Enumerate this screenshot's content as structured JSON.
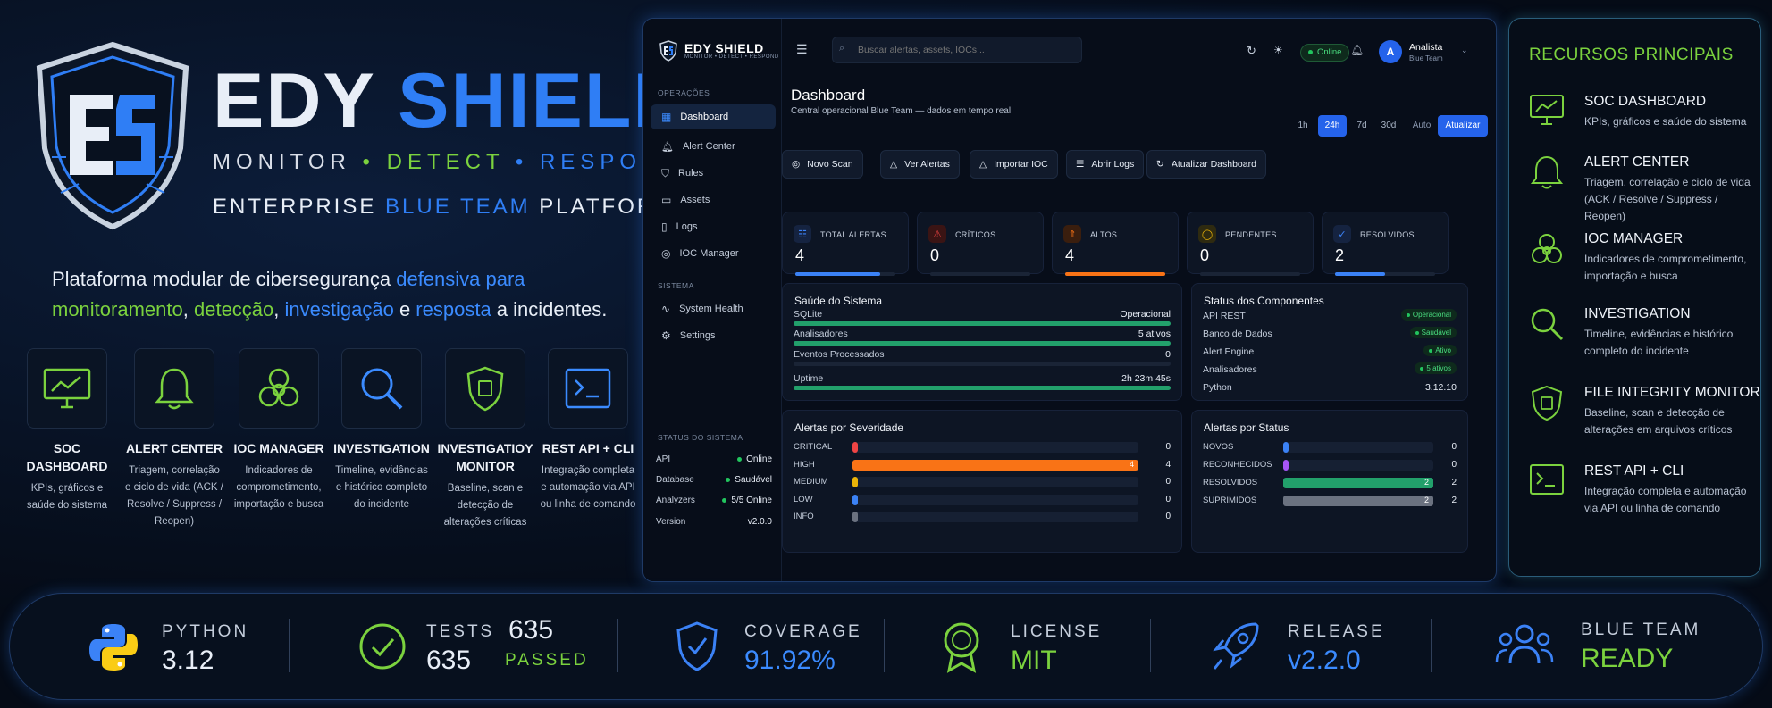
{
  "hero": {
    "brand_white": "EDY ",
    "brand_blue": "SHIELD",
    "tag1": "MONITOR",
    "tag_sep": " • ",
    "tag2": "DETECT",
    "tag3": "RESPOND",
    "plat_a": "ENTERPRISE ",
    "plat_b": "BLUE TEAM",
    "plat_c": " PLATFORM",
    "desc": {
      "p1": "Plataforma modular de cibersegurança ",
      "p2": "defensiva para",
      "p3": "monitoramento",
      "p4": ", ",
      "p5": "detecção",
      "p6": ", ",
      "p7": "investigação",
      "p8": " e ",
      "p9": "resposta",
      "p10": " a incidentes."
    },
    "features": [
      {
        "title": "SOC DASHBOARD",
        "desc": "KPIs, gráficos e saúde do sistema"
      },
      {
        "title": "ALERT CENTER",
        "desc": "Triagem, correlação e ciclo de vida (ACK / Resolve / Suppress / Reopen)"
      },
      {
        "title": "IOC MANAGER",
        "desc": "Indicadores de comprometimento, importação e busca"
      },
      {
        "title": "INVESTIGATION",
        "desc": "Timeline, evidências e histórico completo do incidente"
      },
      {
        "title": "INVESTIGATIOY MONITOR",
        "desc": "Baseline, scan e detecção de alterações críticas"
      },
      {
        "title": "REST API + CLI",
        "desc": "Integração completa e automação via API ou linha de comando"
      }
    ]
  },
  "app": {
    "logo_name": "EDY SHIELD",
    "logo_sub": "MONITOR • DETECT • RESPOND",
    "sec_ops": "OPERAÇÕES",
    "sec_sys": "SISTEMA",
    "nav": [
      "Dashboard",
      "Alert Center",
      "Rules",
      "Assets",
      "Logs",
      "IOC Manager"
    ],
    "nav_sys": [
      "System Health",
      "Settings"
    ],
    "status_title": "STATUS DO SISTEMA",
    "status": [
      {
        "k": "API",
        "v": "Online"
      },
      {
        "k": "Database",
        "v": "Saudável"
      },
      {
        "k": "Analyzers",
        "v": "5/5 Online"
      },
      {
        "k": "Version",
        "v": "v2.0.0"
      }
    ],
    "search_placeholder": "Buscar alertas, assets, IOCs...",
    "online": "Online",
    "avatar_letter": "A",
    "user_name": "Analista",
    "user_role": "Blue Team",
    "page_title": "Dashboard",
    "page_sub": "Central operacional Blue Team — dados em tempo real",
    "ranges": [
      "1h",
      "24h",
      "7d",
      "30d"
    ],
    "auto": "Auto",
    "update": "Atualizar",
    "actions": [
      "Novo Scan",
      "Ver Alertas",
      "Importar IOC",
      "Abrir Logs",
      "Atualizar Dashboard"
    ],
    "kpis": [
      {
        "label": "TOTAL ALERTAS",
        "value": "4",
        "fill": 0.85,
        "color": "#3b82f6"
      },
      {
        "label": "CRÍTICOS",
        "value": "0",
        "fill": 0,
        "color": "#ef4444"
      },
      {
        "label": "ALTOS",
        "value": "4",
        "fill": 1.0,
        "color": "#f97316"
      },
      {
        "label": "PENDENTES",
        "value": "0",
        "fill": 0,
        "color": "#eab308"
      },
      {
        "label": "RESOLVIDOS",
        "value": "2",
        "fill": 0.5,
        "color": "#3b82f6"
      }
    ],
    "health_title": "Saúde do Sistema",
    "health": [
      {
        "k": "SQLite",
        "v": "Operacional",
        "fill": 1.0
      },
      {
        "k": "Analisadores",
        "v": "5 ativos",
        "fill": 1.0
      },
      {
        "k": "Eventos Processados",
        "v": "0",
        "fill": 0
      },
      {
        "k": "Uptime",
        "v": "2h 23m 45s",
        "fill": 1.0
      }
    ],
    "comp_title": "Status dos Componentes",
    "components": [
      {
        "k": "API REST",
        "v": "Operacional"
      },
      {
        "k": "Banco de Dados",
        "v": "Saudável"
      },
      {
        "k": "Alert Engine",
        "v": "Ativo"
      },
      {
        "k": "Analisadores",
        "v": "5 ativos"
      },
      {
        "k": "Python",
        "v": "3.12.10"
      }
    ],
    "sev_title": "Alertas por Severidade",
    "severity": [
      {
        "k": "CRITICAL",
        "v": "0",
        "fill": 0,
        "color": "#ef4444"
      },
      {
        "k": "HIGH",
        "v": "4",
        "fill": 1.0,
        "color": "#f97316",
        "inner": "4"
      },
      {
        "k": "MEDIUM",
        "v": "0",
        "fill": 0,
        "color": "#eab308"
      },
      {
        "k": "LOW",
        "v": "0",
        "fill": 0,
        "color": "#3b82f6"
      },
      {
        "k": "INFO",
        "v": "0",
        "fill": 0,
        "color": "#6b7280"
      }
    ],
    "stat_title": "Alertas por Status",
    "statuses": [
      {
        "k": "NOVOS",
        "v": "0",
        "fill": 0,
        "color": "#3b82f6"
      },
      {
        "k": "RECONHECIDOS",
        "v": "0",
        "fill": 0,
        "color": "#a855f7"
      },
      {
        "k": "RESOLVIDOS",
        "v": "2",
        "fill": 1.0,
        "color": "#22a06b",
        "inner": "2"
      },
      {
        "k": "SUPRIMIDOS",
        "v": "2",
        "fill": 1.0,
        "color": "#6b7280",
        "inner": "2"
      }
    ]
  },
  "resources": {
    "title": "RECURSOS PRINCIPAIS",
    "items": [
      {
        "title": "SOC DASHBOARD",
        "desc": "KPIs, gráficos e saúde do sistema"
      },
      {
        "title": "ALERT CENTER",
        "desc": "Triagem, correlação e ciclo de vida (ACK / Resolve / Suppress / Reopen)"
      },
      {
        "title": "IOC MANAGER",
        "desc": "Indicadores de comprometimento, importação e busca"
      },
      {
        "title": "INVESTIGATION",
        "desc": "Timeline, evidências e histórico completo do incidente"
      },
      {
        "title": "FILE INTEGRITY MONITOR",
        "desc": "Baseline, scan e detecção de alterações em arquivos críticos"
      },
      {
        "title": "REST API + CLI",
        "desc": "Integração completa e automação via API ou linha de comando"
      }
    ]
  },
  "stats": {
    "python_k": "PYTHON",
    "python_v": "3.12",
    "tests_k": "TESTS",
    "tests_n1": "635",
    "tests_n2": "635",
    "tests_p": "PASSED",
    "coverage_k": "COVERAGE",
    "coverage_v": "91.92%",
    "license_k": "LICENSE",
    "license_v": "MIT",
    "release_k": "RELEASE",
    "release_v": "v2.2.0",
    "team_k": "BLUE TEAM",
    "team_v": "READY"
  },
  "colors": {
    "accent_blue": "#2f7ef5",
    "accent_green": "#7bd23e"
  }
}
